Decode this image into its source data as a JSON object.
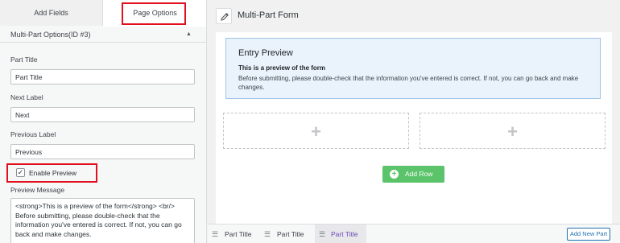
{
  "tabs": {
    "add_fields": "Add Fields",
    "page_options": "Page Options"
  },
  "section": {
    "title": "Multi-Part Options(ID #3)",
    "caret": "▲"
  },
  "fields": {
    "part_title_label": "Part Title",
    "part_title_value": "Part Title",
    "next_label": "Next Label",
    "next_value": "Next",
    "previous_label": "Previous Label",
    "previous_value": "Previous",
    "enable_preview_label": "Enable Preview",
    "enable_preview_checked": true,
    "preview_message_label": "Preview Message",
    "preview_message_value": "<strong>This is a preview of the form</strong> <br/> Before submitting, please double-check that the information you've entered is correct. If not, you can go back and make changes."
  },
  "form": {
    "title": "Multi-Part Form"
  },
  "entry_preview": {
    "title": "Entry Preview",
    "bold_line": "This is a preview of the form",
    "body": "Before submitting, please double-check that the information you've entered is correct. If not, you can go back and make changes."
  },
  "canvas": {
    "add_row_label": "Add Row"
  },
  "parts": [
    {
      "label": "Part Title",
      "active": false
    },
    {
      "label": "Part Title",
      "active": false
    },
    {
      "label": "Part Title",
      "active": true
    }
  ],
  "add_new_part_label": "Add New Part",
  "icons": {
    "pencil": "pencil-icon",
    "plus": "plus-icon",
    "grip": "drag-handle-icon",
    "checkmark": "checkmark-icon"
  },
  "colors": {
    "highlight": "#e0101e",
    "add_row": "#5bc46a",
    "active_part": "#6c4ab6",
    "link_blue": "#2271b1"
  }
}
